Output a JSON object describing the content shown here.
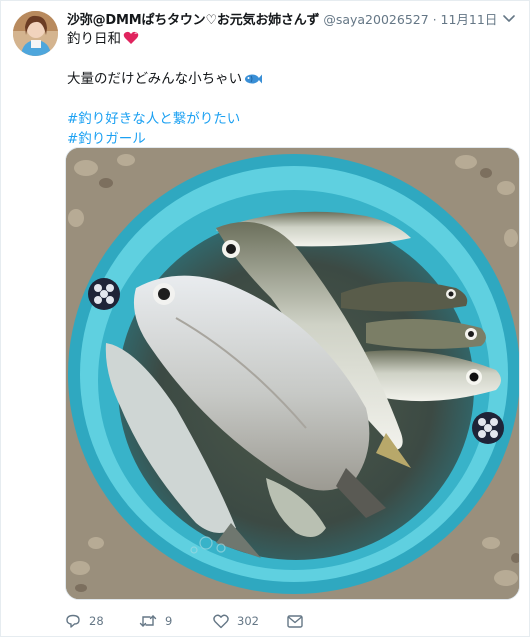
{
  "tweet": {
    "display_name": "沙弥@DMMぱちタウン♡お元気お姉さんず",
    "handle": "@saya20026527",
    "separator": "·",
    "timestamp": "11月11日",
    "text_line1": "釣り日和",
    "text_line2": "大量のだけどみんな小ちゃい",
    "hashtag1": "#釣り好きな人と繋がりたい",
    "hashtag2": "#釣りガール",
    "emoji1": "heart-icon",
    "emoji2": "fish-icon"
  },
  "actions": {
    "reply_count": "28",
    "retweet_count": "9",
    "like_count": "302"
  },
  "colors": {
    "link": "#1da1f2",
    "secondary": "#657786",
    "text": "#14171a",
    "bucket": "#39b9d0",
    "heart": "#e0245e",
    "fish_emoji": "#3a8fd6"
  },
  "icons": [
    "reply-icon",
    "retweet-icon",
    "like-icon",
    "direct-message-icon",
    "caret-down-icon"
  ]
}
